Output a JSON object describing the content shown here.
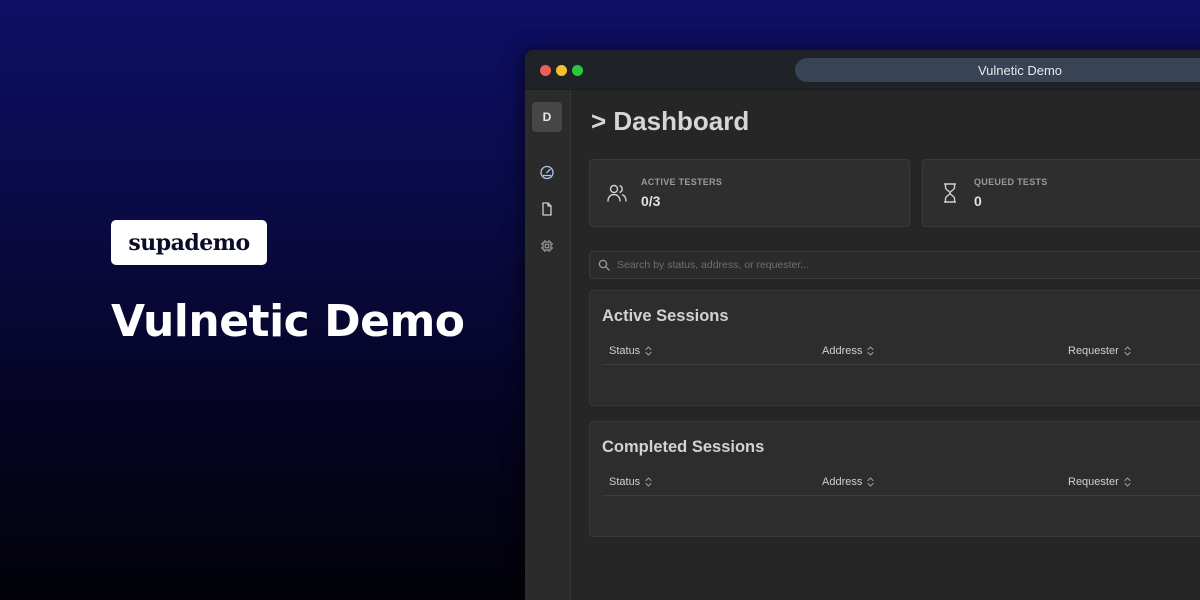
{
  "brand": {
    "logo_text": "supademo"
  },
  "hero": {
    "title": "Vulnetic Demo"
  },
  "window": {
    "address_title": "Vulnetic Demo"
  },
  "sidebar": {
    "avatar_initial": "D",
    "items": [
      {
        "name": "dashboard",
        "icon": "gauge-icon"
      },
      {
        "name": "documents",
        "icon": "file-icon"
      },
      {
        "name": "integrations",
        "icon": "chip-icon"
      }
    ]
  },
  "dashboard": {
    "title": "> Dashboard",
    "stats": [
      {
        "label": "ACTIVE TESTERS",
        "value": "0/3",
        "icon": "users-icon"
      },
      {
        "label": "QUEUED TESTS",
        "value": "0",
        "icon": "hourglass-icon"
      }
    ],
    "search": {
      "placeholder": "Search by status, address, or requester..."
    },
    "active_sessions": {
      "title": "Active Sessions",
      "columns": [
        "Status",
        "Address",
        "Requester"
      ]
    },
    "completed_sessions": {
      "title": "Completed Sessions",
      "columns": [
        "Status",
        "Address",
        "Requester"
      ]
    }
  },
  "colors": {
    "accent_dots": [
      "#ee5f57",
      "#f5bf2f",
      "#29c840"
    ],
    "background_top": "#0e0f66",
    "window_bg": "#262626"
  }
}
